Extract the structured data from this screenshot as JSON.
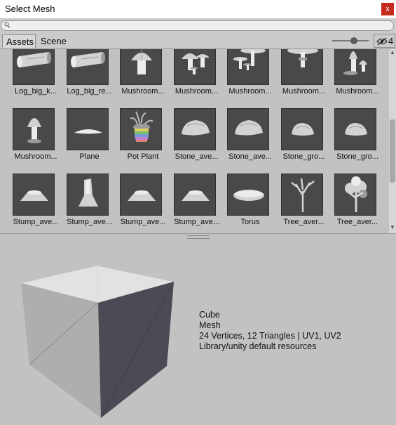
{
  "window": {
    "title": "Select Mesh",
    "close_label": "x"
  },
  "search": {
    "value": "",
    "placeholder": ""
  },
  "tabs": [
    {
      "label": "Assets",
      "active": true
    },
    {
      "label": "Scene",
      "active": false
    }
  ],
  "toolbar": {
    "hidden_count": "4",
    "icon_size_level": 0.6
  },
  "assets": [
    {
      "label": "Log_big_k...",
      "icon": "log"
    },
    {
      "label": "Log_big_re...",
      "icon": "log"
    },
    {
      "label": "Mushroom...",
      "icon": "mushroom-round"
    },
    {
      "label": "Mushroom...",
      "icon": "mushroom-cluster"
    },
    {
      "label": "Mushroom...",
      "icon": "mushroom-flat"
    },
    {
      "label": "Mushroom...",
      "icon": "mushroom-tall"
    },
    {
      "label": "Mushroom...",
      "icon": "mushroom-bell-group"
    },
    {
      "label": "Mushroom...",
      "icon": "mushroom-bell"
    },
    {
      "label": "Plane",
      "icon": "plane"
    },
    {
      "label": "Pot Plant",
      "icon": "pot-plant"
    },
    {
      "label": "Stone_ave...",
      "icon": "stone"
    },
    {
      "label": "Stone_ave...",
      "icon": "stone"
    },
    {
      "label": "Stone_gro...",
      "icon": "stone-small"
    },
    {
      "label": "Stone_gro...",
      "icon": "stone-small"
    },
    {
      "label": "Stump_ave...",
      "icon": "stump"
    },
    {
      "label": "Stump_ave...",
      "icon": "stump-tall"
    },
    {
      "label": "Stump_ave...",
      "icon": "stump"
    },
    {
      "label": "Stump_ave...",
      "icon": "stump"
    },
    {
      "label": "Torus",
      "icon": "torus"
    },
    {
      "label": "Tree_aver...",
      "icon": "tree-bare"
    },
    {
      "label": "Tree_aver...",
      "icon": "tree-leafy"
    }
  ],
  "preview": {
    "name": "Cube",
    "type": "Mesh",
    "stats": "24 Vertices, 12 Triangles | UV1, UV2",
    "path": "Library/unity default resources"
  },
  "colors": {
    "background": "#c2c2c2",
    "thumbnail_bg": "#494949",
    "close_button": "#c42b1c"
  }
}
